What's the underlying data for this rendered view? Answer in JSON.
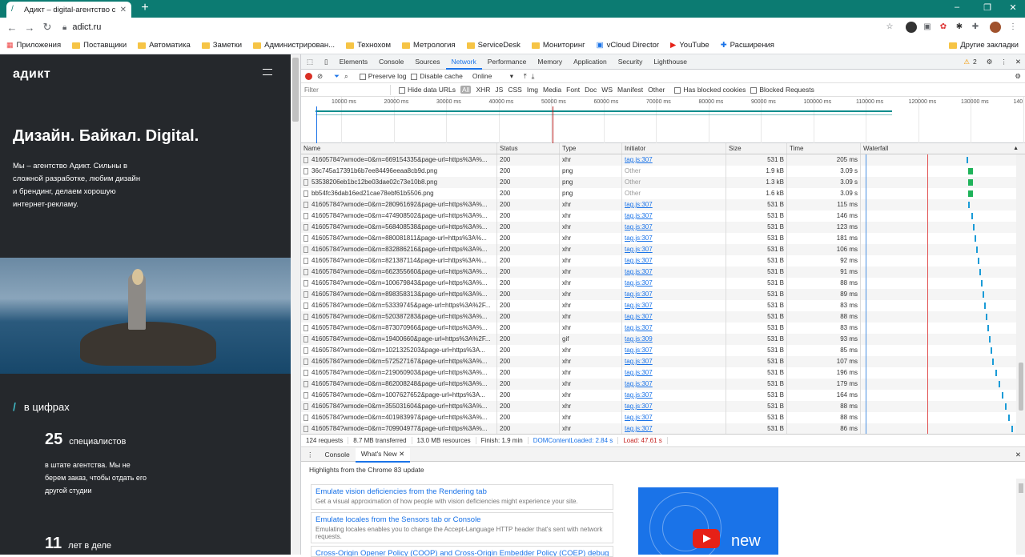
{
  "browser": {
    "tab_title": "Адикт – digital-агентство с Байк",
    "url": "adict.ru",
    "bookmarks": [
      "Приложения",
      "Поставщики",
      "Автоматика",
      "Заметки",
      "Администрирован...",
      "Технохом",
      "Метрология",
      "ServiceDesk",
      "Мониторинг",
      "vCloud Director",
      "YouTube",
      "Расширения"
    ],
    "other_bookmarks": "Другие закладки"
  },
  "page": {
    "logo": "адикт",
    "hero_title": "Дизайн. Байкал. Digital.",
    "hero_desc": "Мы – агентство Адикт. Сильны в сложной разработке, любим дизайн и брендинг, делаем хорошую интернет-рекламу.",
    "section_title": "в цифрах",
    "stat1_num": "25",
    "stat1_label": "специалистов",
    "stat1_desc": "в штате агентства. Мы не берем заказ, чтобы отдать его другой студии",
    "stat2_num": "11",
    "stat2_label": "лет в деле"
  },
  "devtools": {
    "tabs": [
      "Elements",
      "Console",
      "Sources",
      "Network",
      "Performance",
      "Memory",
      "Application",
      "Security",
      "Lighthouse"
    ],
    "warnings": "2",
    "toolbar": {
      "preserve_log": "Preserve log",
      "disable_cache": "Disable cache",
      "throttle": "Online"
    },
    "filter": {
      "placeholder": "Filter",
      "hide_data_urls": "Hide data URLs",
      "types": [
        "All",
        "XHR",
        "JS",
        "CSS",
        "Img",
        "Media",
        "Font",
        "Doc",
        "WS",
        "Manifest",
        "Other"
      ],
      "blocked_cookies": "Has blocked cookies",
      "blocked_requests": "Blocked Requests"
    },
    "overview_ticks": [
      "10000 ms",
      "20000 ms",
      "30000 ms",
      "40000 ms",
      "50000 ms",
      "60000 ms",
      "70000 ms",
      "80000 ms",
      "90000 ms",
      "100000 ms",
      "110000 ms",
      "120000 ms",
      "130000 ms",
      "140"
    ],
    "columns": [
      "Name",
      "Status",
      "Type",
      "Initiator",
      "Size",
      "Time",
      "Waterfall"
    ],
    "rows": [
      {
        "name": "41605784?wmode=0&rn=669154335&page-url=https%3A%...",
        "status": "200",
        "type": "xhr",
        "init": "tag.js:307",
        "size": "531 B",
        "time": "205 ms",
        "wf": 0.66,
        "big": false
      },
      {
        "name": "36c745a17391b6b7ee84496eeaa8cb9d.png",
        "status": "200",
        "type": "png",
        "init": "Other",
        "size": "1.9 kB",
        "time": "3.09 s",
        "wf": 0.67,
        "big": true
      },
      {
        "name": "53538206eb1bc12be03dae02c73e10b8.png",
        "status": "200",
        "type": "png",
        "init": "Other",
        "size": "1.3 kB",
        "time": "3.09 s",
        "wf": 0.67,
        "big": true
      },
      {
        "name": "bb54fc36dab16ed21cae78ebf61b5506.png",
        "status": "200",
        "type": "png",
        "init": "Other",
        "size": "1.6 kB",
        "time": "3.09 s",
        "wf": 0.67,
        "big": true
      },
      {
        "name": "41605784?wmode=0&rn=280961692&page-url=https%3A%...",
        "status": "200",
        "type": "xhr",
        "init": "tag.js:307",
        "size": "531 B",
        "time": "115 ms",
        "wf": 0.67,
        "big": false
      },
      {
        "name": "41605784?wmode=0&rn=474908502&page-url=https%3A%...",
        "status": "200",
        "type": "xhr",
        "init": "tag.js:307",
        "size": "531 B",
        "time": "146 ms",
        "wf": 0.69,
        "big": false
      },
      {
        "name": "41605784?wmode=0&rn=568408538&page-url=https%3A%...",
        "status": "200",
        "type": "xhr",
        "init": "tag.js:307",
        "size": "531 B",
        "time": "123 ms",
        "wf": 0.7,
        "big": false
      },
      {
        "name": "41605784?wmode=0&rn=880081811&page-url=https%3A%...",
        "status": "200",
        "type": "xhr",
        "init": "tag.js:307",
        "size": "531 B",
        "time": "181 ms",
        "wf": 0.71,
        "big": false
      },
      {
        "name": "41605784?wmode=0&rn=832886216&page-url=https%3A%...",
        "status": "200",
        "type": "xhr",
        "init": "tag.js:307",
        "size": "531 B",
        "time": "106 ms",
        "wf": 0.72,
        "big": false
      },
      {
        "name": "41605784?wmode=0&rn=821387114&page-url=https%3A%...",
        "status": "200",
        "type": "xhr",
        "init": "tag.js:307",
        "size": "531 B",
        "time": "92 ms",
        "wf": 0.73,
        "big": false
      },
      {
        "name": "41605784?wmode=0&rn=662355660&page-url=https%3A%...",
        "status": "200",
        "type": "xhr",
        "init": "tag.js:307",
        "size": "531 B",
        "time": "91 ms",
        "wf": 0.74,
        "big": false
      },
      {
        "name": "41605784?wmode=0&rn=100679843&page-url=https%3A%...",
        "status": "200",
        "type": "xhr",
        "init": "tag.js:307",
        "size": "531 B",
        "time": "88 ms",
        "wf": 0.75,
        "big": false
      },
      {
        "name": "41605784?wmode=0&rn=898358313&page-url=https%3A%...",
        "status": "200",
        "type": "xhr",
        "init": "tag.js:307",
        "size": "531 B",
        "time": "89 ms",
        "wf": 0.76,
        "big": false
      },
      {
        "name": "41605784?wmode=0&rn=53339745&page-url=https%3A%2F...",
        "status": "200",
        "type": "xhr",
        "init": "tag.js:307",
        "size": "531 B",
        "time": "83 ms",
        "wf": 0.77,
        "big": false
      },
      {
        "name": "41605784?wmode=0&rn=520387283&page-url=https%3A%...",
        "status": "200",
        "type": "xhr",
        "init": "tag.js:307",
        "size": "531 B",
        "time": "88 ms",
        "wf": 0.78,
        "big": false
      },
      {
        "name": "41605784?wmode=0&rn=873070966&page-url=https%3A%...",
        "status": "200",
        "type": "xhr",
        "init": "tag.js:307",
        "size": "531 B",
        "time": "83 ms",
        "wf": 0.79,
        "big": false
      },
      {
        "name": "41605784?wmode=0&rn=19400660&page-url=https%3A%2F...",
        "status": "200",
        "type": "gif",
        "init": "tag.js:309",
        "size": "531 B",
        "time": "93 ms",
        "wf": 0.8,
        "big": false
      },
      {
        "name": "41605784?wmode=0&rn=1021325203&page-url=https%3A...",
        "status": "200",
        "type": "xhr",
        "init": "tag.js:307",
        "size": "531 B",
        "time": "85 ms",
        "wf": 0.81,
        "big": false
      },
      {
        "name": "41605784?wmode=0&rn=572527167&page-url=https%3A%...",
        "status": "200",
        "type": "xhr",
        "init": "tag.js:307",
        "size": "531 B",
        "time": "107 ms",
        "wf": 0.82,
        "big": false
      },
      {
        "name": "41605784?wmode=0&rn=219060903&page-url=https%3A%...",
        "status": "200",
        "type": "xhr",
        "init": "tag.js:307",
        "size": "531 B",
        "time": "196 ms",
        "wf": 0.84,
        "big": false
      },
      {
        "name": "41605784?wmode=0&rn=862008248&page-url=https%3A%...",
        "status": "200",
        "type": "xhr",
        "init": "tag.js:307",
        "size": "531 B",
        "time": "179 ms",
        "wf": 0.86,
        "big": false
      },
      {
        "name": "41605784?wmode=0&rn=1007627652&page-url=https%3A...",
        "status": "200",
        "type": "xhr",
        "init": "tag.js:307",
        "size": "531 B",
        "time": "164 ms",
        "wf": 0.88,
        "big": false
      },
      {
        "name": "41605784?wmode=0&rn=355031604&page-url=https%3A%...",
        "status": "200",
        "type": "xhr",
        "init": "tag.js:307",
        "size": "531 B",
        "time": "88 ms",
        "wf": 0.9,
        "big": false
      },
      {
        "name": "41605784?wmode=0&rn=401983997&page-url=https%3A%...",
        "status": "200",
        "type": "xhr",
        "init": "tag.js:307",
        "size": "531 B",
        "time": "88 ms",
        "wf": 0.92,
        "big": false
      },
      {
        "name": "41605784?wmode=0&rn=709904977&page-url=https%3A%...",
        "status": "200",
        "type": "xhr",
        "init": "tag.js:307",
        "size": "531 B",
        "time": "86 ms",
        "wf": 0.94,
        "big": false
      }
    ],
    "summary": {
      "requests": "124 requests",
      "transferred": "8.7 MB transferred",
      "resources": "13.0 MB resources",
      "finish": "Finish: 1.9 min",
      "dcl": "DOMContentLoaded: 2.84 s",
      "load": "Load: 47.61 s"
    },
    "drawer": {
      "tabs": [
        "Console",
        "What's New"
      ],
      "heading": "Highlights from the Chrome 83 update",
      "cards": [
        {
          "title": "Emulate vision deficiencies from the Rendering tab",
          "sub": "Get a visual approximation of how people with vision deficiencies might experience your site."
        },
        {
          "title": "Emulate locales from the Sensors tab or Console",
          "sub": "Emulating locales enables you to change the Accept-Language HTTP header that's sent with network requests."
        },
        {
          "title": "Cross-Origin Opener Policy (COOP) and Cross-Origin Embedder Policy (COEP) debugging",
          "sub": ""
        }
      ],
      "promo_text": "new"
    }
  }
}
